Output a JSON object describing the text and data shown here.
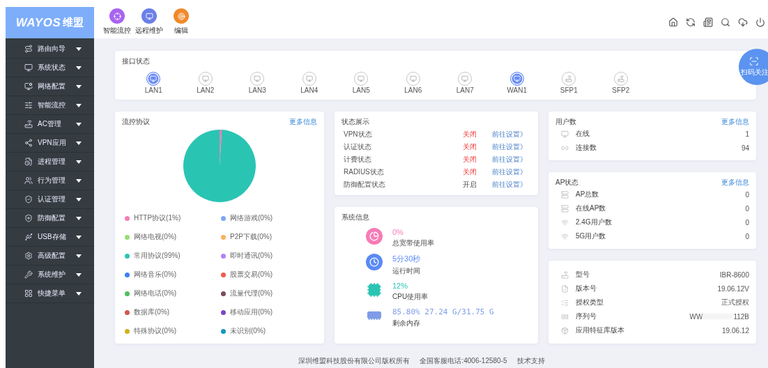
{
  "logo": {
    "brand": "WAYOS",
    "brand_cn": "维盟"
  },
  "quick_apps": [
    {
      "label": "智能流控"
    },
    {
      "label": "远程维护"
    },
    {
      "label": "编辑"
    }
  ],
  "sidebar": {
    "items": [
      {
        "label": "路由向导"
      },
      {
        "label": "系统状态"
      },
      {
        "label": "网络配置"
      },
      {
        "label": "智能流控"
      },
      {
        "label": "AC管理"
      },
      {
        "label": "VPN应用"
      },
      {
        "label": "进程管理"
      },
      {
        "label": "行为管理"
      },
      {
        "label": "认证管理"
      },
      {
        "label": "防御配置"
      },
      {
        "label": "USB存储"
      },
      {
        "label": "高级配置"
      },
      {
        "label": "系统维护"
      },
      {
        "label": "快捷菜单"
      }
    ]
  },
  "interfaces": {
    "title": "接口状态",
    "ports": [
      {
        "label": "LAN1",
        "kind": "lan",
        "up": true
      },
      {
        "label": "LAN2",
        "kind": "lan",
        "up": false
      },
      {
        "label": "LAN3",
        "kind": "lan",
        "up": false
      },
      {
        "label": "LAN4",
        "kind": "lan",
        "up": false
      },
      {
        "label": "LAN5",
        "kind": "lan",
        "up": false
      },
      {
        "label": "LAN6",
        "kind": "lan",
        "up": false
      },
      {
        "label": "LAN7",
        "kind": "lan",
        "up": false
      },
      {
        "label": "WAN1",
        "kind": "lan",
        "up": true
      },
      {
        "label": "SFP1",
        "kind": "sfp",
        "up": false
      },
      {
        "label": "SFP2",
        "kind": "sfp",
        "up": false
      }
    ]
  },
  "flow": {
    "title": "流控协议",
    "more": "更多信息",
    "chart_data": {
      "type": "pie",
      "values": [
        1,
        0,
        0,
        0,
        99,
        0,
        0,
        0,
        0,
        0,
        0,
        0,
        0,
        0
      ]
    },
    "legend": [
      {
        "label": "HTTP协议(1%)",
        "color": "#f67cb6"
      },
      {
        "label": "网络游戏(0%)",
        "color": "#7ea6f7"
      },
      {
        "label": "网络电视(0%)",
        "color": "#98dd74"
      },
      {
        "label": "P2P下载(0%)",
        "color": "#fbb25c"
      },
      {
        "label": "常用协议(99%)",
        "color": "#2ac4b3"
      },
      {
        "label": "即时通讯(0%)",
        "color": "#b380f5"
      },
      {
        "label": "网络音乐(0%)",
        "color": "#3d7ff0"
      },
      {
        "label": "股票交易(0%)",
        "color": "#ee5b4e"
      },
      {
        "label": "网络电话(0%)",
        "color": "#4ec05c"
      },
      {
        "label": "流量代理(0%)",
        "color": "#7e4a5e"
      },
      {
        "label": "数据库(0%)",
        "color": "#d0574d"
      },
      {
        "label": "移动应用(0%)",
        "color": "#7c45c8"
      },
      {
        "label": "特殊协议(0%)",
        "color": "#cbb41a"
      },
      {
        "label": "未识别(0%)",
        "color": "#1696c4"
      }
    ]
  },
  "status": {
    "title": "状态展示",
    "rows": [
      {
        "name": "VPN状态",
        "value": "关闭",
        "on": false,
        "link": "前往设置》"
      },
      {
        "name": "认证状态",
        "value": "关闭",
        "on": false,
        "link": "前往设置》"
      },
      {
        "name": "计费状态",
        "value": "关闭",
        "on": false,
        "link": "前往设置》"
      },
      {
        "name": "RADIUS状态",
        "value": "关闭",
        "on": false,
        "link": "前往设置》"
      },
      {
        "name": "防御配置状态",
        "value": "开启",
        "on": true,
        "link": "前往设置》"
      }
    ]
  },
  "sysinfo": {
    "title": "系统信息",
    "items": [
      {
        "kind": "bandwidth",
        "value": "0%",
        "label": "总宽带使用率",
        "color": "#f67cb6"
      },
      {
        "kind": "uptime",
        "value": "5分30秒",
        "label": "运行时间",
        "color": "#5b8af5"
      },
      {
        "kind": "cpu",
        "value": "12%",
        "label": "CPU使用率",
        "color": "#2ac4b3"
      },
      {
        "kind": "memory",
        "value": "85.80% 27.24 G/31.75 G",
        "label": "剩余内存",
        "color": "#7e9ce8"
      }
    ]
  },
  "users": {
    "title": "用户数",
    "more": "更多信息",
    "rows": [
      {
        "name": "在线",
        "value": "1"
      },
      {
        "name": "连接数",
        "value": "94"
      }
    ]
  },
  "ap": {
    "title": "AP状态",
    "more": "更多信息",
    "rows": [
      {
        "name": "AP总数",
        "value": "0"
      },
      {
        "name": "在线AP数",
        "value": "0"
      },
      {
        "name": "2.4G用户数",
        "value": "0"
      },
      {
        "name": "5G用户数",
        "value": "0"
      }
    ]
  },
  "device": {
    "rows": [
      {
        "name": "型号",
        "value": "IBR-8600"
      },
      {
        "name": "版本号",
        "value": "19.06.12V"
      },
      {
        "name": "授权类型",
        "value": "正式授权"
      },
      {
        "name": "序列号",
        "value": "WW",
        "value_tail": "112B"
      },
      {
        "name": "应用特征库版本",
        "value": "19.06.12"
      }
    ]
  },
  "scan_badge": {
    "label": "扫码关注"
  },
  "footer": [
    "深圳维盟科技股份有限公司版权所有",
    "全国客服电话:4006-12580-5",
    "技术支持"
  ]
}
